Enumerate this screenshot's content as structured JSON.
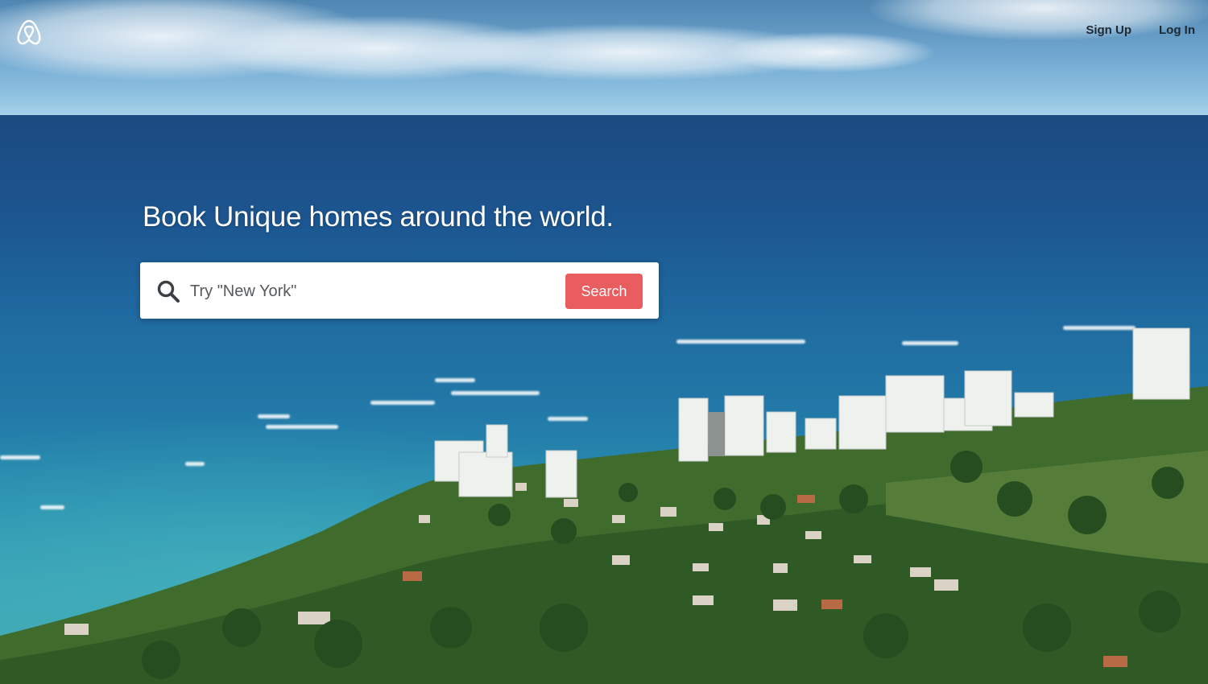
{
  "header": {
    "logo_icon": "airbnb-belo-logo-icon",
    "nav": [
      {
        "label": "Sign Up"
      },
      {
        "label": "Log In"
      }
    ]
  },
  "hero": {
    "title": "Book Unique homes around the world.",
    "background": "aerial-coastline-photo"
  },
  "search": {
    "icon": "search-icon",
    "placeholder": "Try \"New York\"",
    "value": "",
    "button_label": "Search"
  },
  "colors": {
    "accent": "#ea5d5e",
    "nav_text": "#1d2a36",
    "title_text": "#ffffff"
  }
}
